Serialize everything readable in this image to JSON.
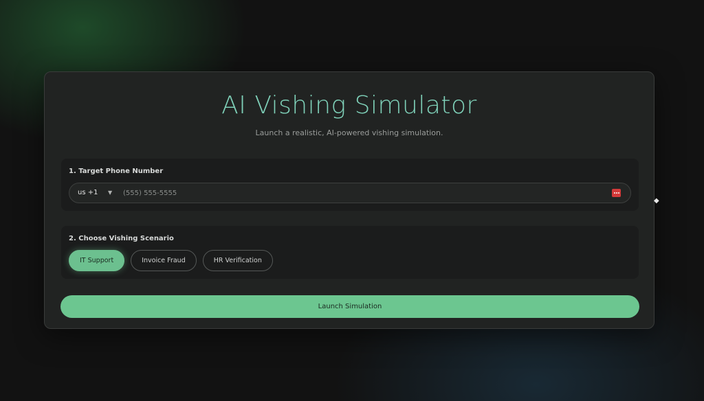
{
  "app": {
    "title": "AI Vishing Simulator",
    "subtitle": "Launch a realistic, AI-powered vishing simulation."
  },
  "phone_section": {
    "label": "1. Target Phone Number",
    "country_code": "us +1",
    "chevron_icon": "chevron-down-icon",
    "placeholder": "(555) 555-5555",
    "value": "",
    "autofill_icon": "password-manager-icon"
  },
  "scenario_section": {
    "label": "2. Choose Vishing Scenario",
    "options": [
      {
        "label": "IT Support",
        "selected": true
      },
      {
        "label": "Invoice Fraud",
        "selected": false
      },
      {
        "label": "HR Verification",
        "selected": false
      }
    ]
  },
  "launch_button": {
    "label": "Launch Simulation"
  },
  "colors": {
    "accent": "#6cc690",
    "title": "#7fd1b9",
    "card_bg": "#212322",
    "panel_bg": "#1b1c1c"
  }
}
